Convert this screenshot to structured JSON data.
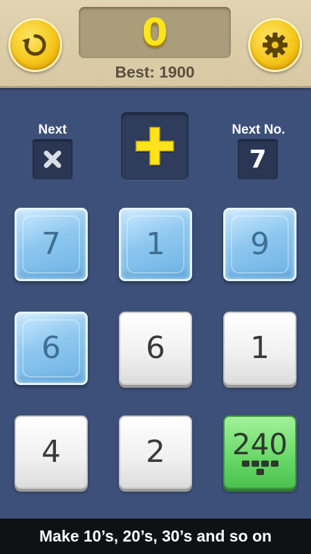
{
  "header": {
    "score": "0",
    "best_label": "Best: 1900",
    "restart_icon": "restart-icon",
    "settings_icon": "gear-icon"
  },
  "operators": {
    "next_label": "Next",
    "next_operator_icon": "multiply-icon",
    "current_operator_icon": "plus-icon",
    "next_number_label": "Next No.",
    "next_number": "7"
  },
  "grid": {
    "tiles": [
      {
        "value": "7",
        "style": "ice"
      },
      {
        "value": "1",
        "style": "ice"
      },
      {
        "value": "9",
        "style": "ice"
      },
      {
        "value": "6",
        "style": "ice"
      },
      {
        "value": "6",
        "style": "white"
      },
      {
        "value": "1",
        "style": "white"
      },
      {
        "value": "4",
        "style": "white"
      },
      {
        "value": "2",
        "style": "white"
      },
      {
        "value": "240",
        "style": "green"
      }
    ]
  },
  "banner": {
    "text": "Make 10’s, 20’s, 30’s and so on"
  },
  "colors": {
    "background": "#3d5079",
    "header": "#e2d4b1",
    "score": "#ffe41c",
    "button_gold": "#f5c61a",
    "ice_tile": "#8dc7ef",
    "green_tile": "#67d867"
  }
}
